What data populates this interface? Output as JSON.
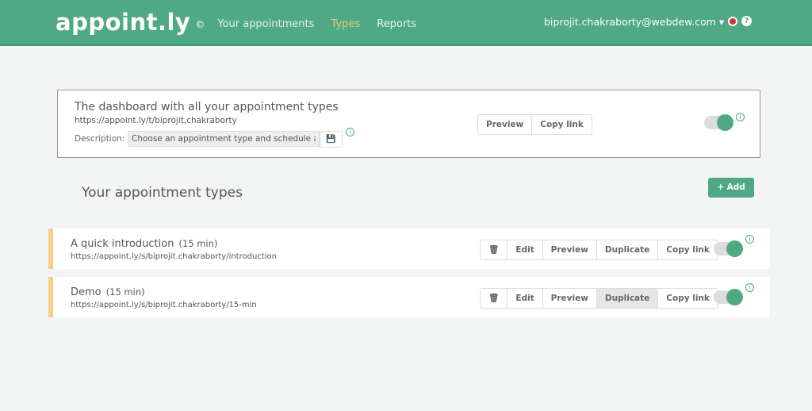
{
  "header": {
    "logo": "appoint.ly",
    "copyright": "©",
    "nav": [
      {
        "label": "Your appointments"
      },
      {
        "label": "Types",
        "active": true
      },
      {
        "label": "Reports"
      }
    ],
    "user": "biprojit.chakraborty@webdew.com ▾",
    "help": "?"
  },
  "dashboard": {
    "title": "The dashboard with all your appointment types",
    "url": "https://appoint.ly/t/biprojit.chakraborty",
    "description_label": "Description:",
    "description_value": "Choose an appointment type and schedule a meeting",
    "save_icon": "💾",
    "preview": "Preview",
    "copy_link": "Copy link",
    "enabled": true,
    "info": "i"
  },
  "section_title": "Your appointment types",
  "add_label": "+  Add",
  "buttons": {
    "delete": "🗑",
    "edit": "Edit",
    "preview": "Preview",
    "duplicate": "Duplicate",
    "copy_link": "Copy link"
  },
  "types": [
    {
      "name": "A quick introduction",
      "duration": "(15 min)",
      "url": "https://appoint.ly/s/biprojit.chakraborty/introduction",
      "enabled": true
    },
    {
      "name": "Demo",
      "duration": "(15 min)",
      "url": "https://appoint.ly/s/biprojit.chakraborty/15-min",
      "enabled": true
    }
  ],
  "colors": {
    "brand": "#4fa985",
    "active_nav": "#e8c77a",
    "row_accent": "#fbcd86"
  }
}
